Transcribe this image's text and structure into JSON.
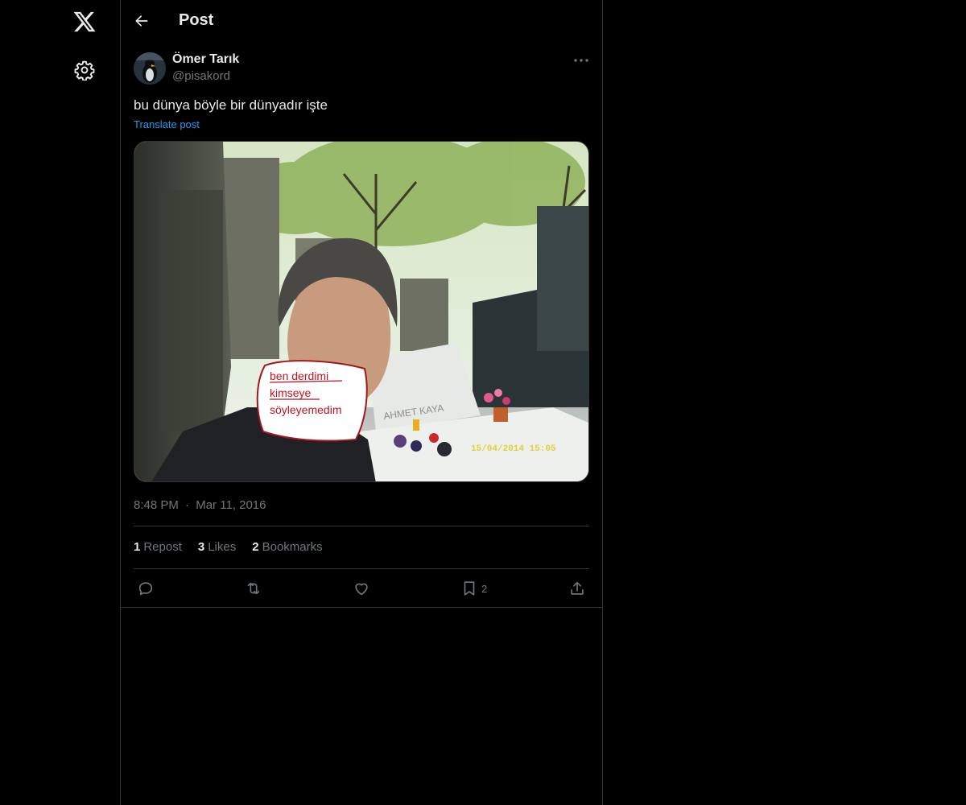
{
  "nav": {
    "logo_icon": "x-logo-icon",
    "settings_icon": "gear-icon"
  },
  "header": {
    "back_icon": "arrow-left-icon",
    "title": "Post"
  },
  "post": {
    "author": {
      "display_name": "Ömer Tarık",
      "handle": "@pisakord"
    },
    "text": "bu dünya böyle bir dünyadır işte",
    "translate_label": "Translate post",
    "media": {
      "caption_lines": [
        "ben derdimi",
        "kimseye",
        "söyleyemedim"
      ],
      "date_stamp": "15/04/2014 15:05",
      "tomb_text": "AHMET KAYA"
    },
    "time": "8:48 PM",
    "separator": "·",
    "date": "Mar 11, 2016",
    "stats": {
      "reposts_count": "1",
      "reposts_label": "Repost",
      "likes_count": "3",
      "likes_label": "Likes",
      "bookmarks_count": "2",
      "bookmarks_label": "Bookmarks"
    },
    "actions": {
      "reply_icon": "reply-icon",
      "repost_icon": "repost-icon",
      "like_icon": "heart-icon",
      "bookmark_icon": "bookmark-icon",
      "bookmark_count": "2",
      "share_icon": "share-icon"
    }
  },
  "colors": {
    "background": "#000000",
    "border": "#2f3336",
    "text_primary": "#e7e9ea",
    "text_secondary": "#71767b",
    "link": "#1d9bf0",
    "caption_red": "#c1121f"
  }
}
